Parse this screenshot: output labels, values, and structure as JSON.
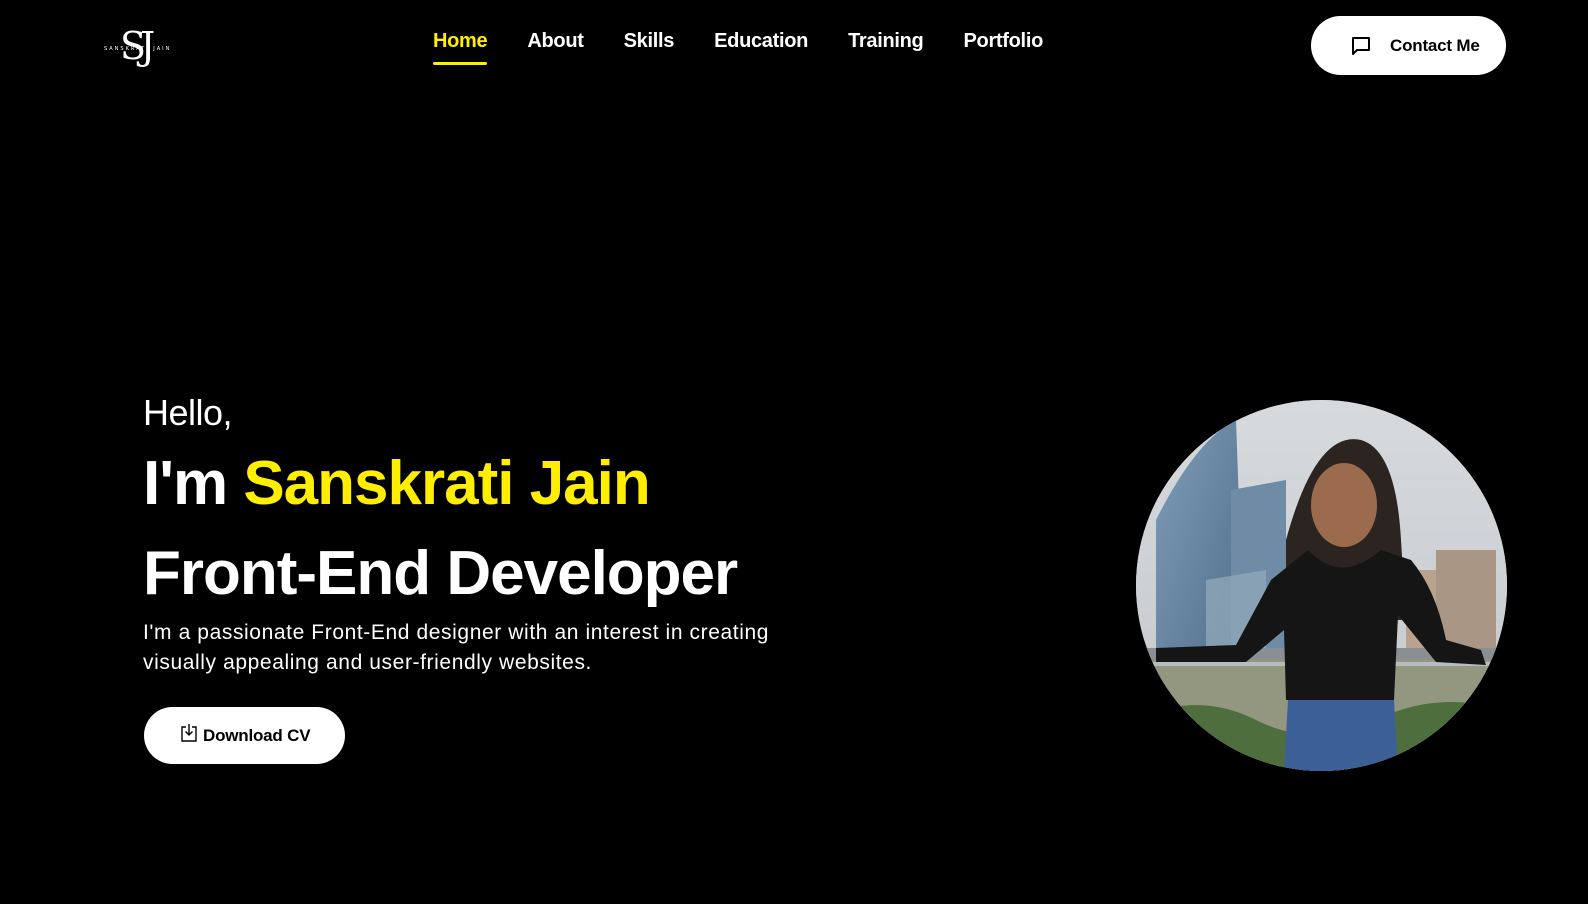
{
  "header": {
    "logo": {
      "monogram": "SJ",
      "subtitle": "SANSKRATI JAIN"
    },
    "nav": [
      {
        "label": "Home",
        "active": true
      },
      {
        "label": "About",
        "active": false
      },
      {
        "label": "Skills",
        "active": false
      },
      {
        "label": "Education",
        "active": false
      },
      {
        "label": "Training",
        "active": false
      },
      {
        "label": "Portfolio",
        "active": false
      }
    ],
    "contact_label": "Contact Me",
    "contact_icon": "message-square-icon"
  },
  "hero": {
    "greeting": "Hello,",
    "intro_prefix": "I'm ",
    "name": "Sanskrati Jain",
    "role": "Front-End Developer",
    "description": "I'm a passionate Front-End designer with an interest in creating visually appealing and user-friendly websites.",
    "download_label": "Download CV",
    "download_icon": "download-icon"
  },
  "colors": {
    "background": "#000000",
    "accent": "#ffee00",
    "text": "#ffffff",
    "button_bg": "#ffffff"
  }
}
